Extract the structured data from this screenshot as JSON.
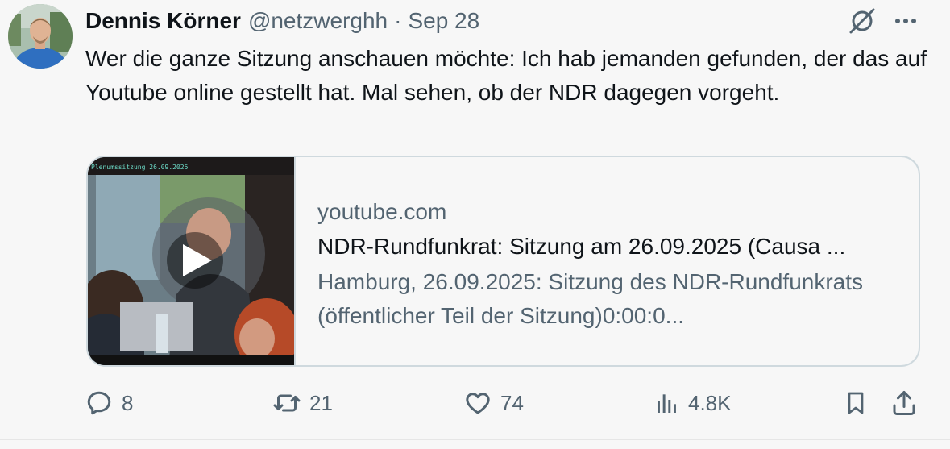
{
  "tweet": {
    "author_name": "Dennis Körner",
    "handle": "@netzwerghh",
    "separator": "·",
    "date": "Sep 28",
    "text": "Wer die ganze Sitzung anschauen möchte: Ich hab jemanden gefunden, der das auf Youtube online gestellt hat. Mal sehen, ob der NDR dagegen vorgeht."
  },
  "card": {
    "domain": "youtube.com",
    "title": "NDR-Rundfunkrat: Sitzung am 26.09.2025 (Causa ...",
    "description": "Hamburg, 26.09.2025: Sitzung des NDR-Rundfunkrats (öffentlicher Teil der Sitzung)0:00:0...",
    "thumbnail_caption": "Plenumssitzung 26.09.2025"
  },
  "actions": {
    "replies": "8",
    "retweets": "21",
    "likes": "74",
    "views": "4.8K"
  },
  "icons": {
    "grok": "grok-icon",
    "more": "more-icon",
    "reply": "reply-icon",
    "retweet": "retweet-icon",
    "like": "heart-icon",
    "views": "views-icon",
    "bookmark": "bookmark-icon",
    "share": "share-icon"
  },
  "colors": {
    "text": "#0f1419",
    "secondary": "#536471",
    "border": "#cfd9de",
    "background": "#f7f7f7"
  }
}
